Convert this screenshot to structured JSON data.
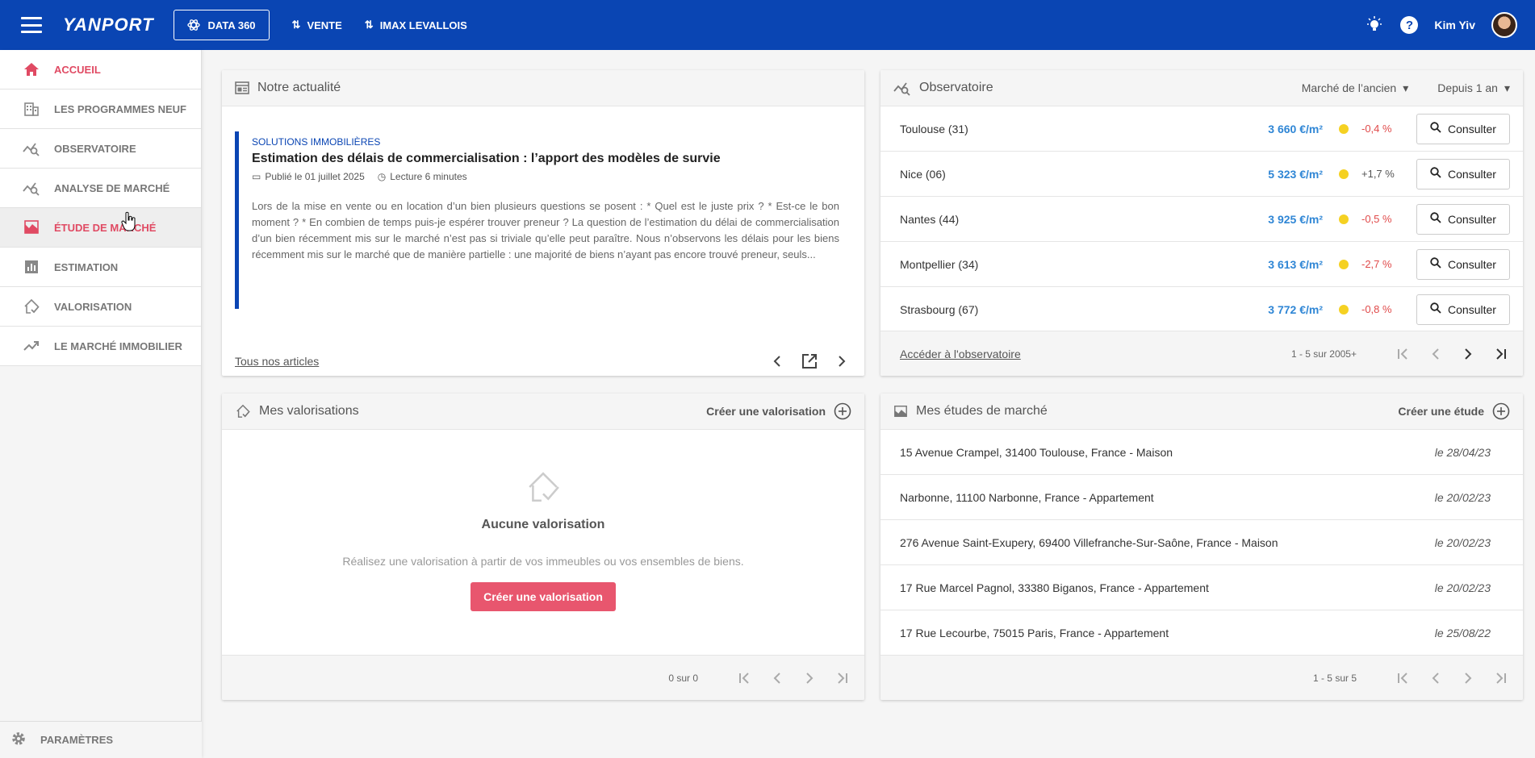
{
  "topbar": {
    "logo_text": "YANPORT",
    "data360_label": "DATA 360",
    "vente_label": "VENTE",
    "agency_label": "IMAX LEVALLOIS",
    "user_name": "Kim Yiv",
    "help_glyph": "?",
    "brand_color": "#0a45b3"
  },
  "sidebar": {
    "items": [
      {
        "label": "ACCUEIL",
        "icon": "home-icon"
      },
      {
        "label": "LES PROGRAMMES NEUF",
        "icon": "building-icon"
      },
      {
        "label": "OBSERVATOIRE",
        "icon": "chart-search-icon"
      },
      {
        "label": "ANALYSE DE MARCHÉ",
        "icon": "chart-search-icon"
      },
      {
        "label": "ÉTUDE DE MARCHÉ",
        "icon": "landscape-chart-icon"
      },
      {
        "label": "ESTIMATION",
        "icon": "bar-chart-icon"
      },
      {
        "label": "VALORISATION",
        "icon": "house-check-icon"
      },
      {
        "label": "LE MARCHÉ IMMOBILIER",
        "icon": "trending-up-icon"
      }
    ],
    "settings_label": "PARAMÈTRES",
    "accent_color": "#e04a63"
  },
  "news": {
    "title": "Notre actualité",
    "category": "SOLUTIONS IMMOBILIÈRES",
    "headline": "Estimation des délais de commercialisation : l’apport des modèles de survie",
    "published": "Publié le 01 juillet 2025",
    "reading": "Lecture 6 minutes",
    "text": "Lors de la mise en vente ou en location d’un bien plusieurs questions se posent : * Quel est le juste prix ? * Est-ce le bon moment ? * En combien de temps puis-je espérer trouver preneur ? La question de l’estimation du délai de commercialisation d’un bien récemment mis sur le marché n’est pas si triviale qu’elle peut paraître. Nous n’observons les délais pour les biens récemment mis sur le marché que de manière partielle : une majorité de biens n’ayant pas encore trouvé preneur, seuls...",
    "all_articles": "Tous nos articles"
  },
  "observatoire": {
    "title": "Observatoire",
    "market_select": "Marché de l’ancien",
    "period_select": "Depuis 1 an",
    "consult_label": "Consulter",
    "rows": [
      {
        "city": "Toulouse (31)",
        "price": "3 660 €/m²",
        "variation": "-0,4 %"
      },
      {
        "city": "Nice (06)",
        "price": "5 323 €/m²",
        "variation": "+1,7 %"
      },
      {
        "city": "Nantes (44)",
        "price": "3 925 €/m²",
        "variation": "-0,5 %"
      },
      {
        "city": "Montpellier (34)",
        "price": "3 613 €/m²",
        "variation": "-2,7 %"
      },
      {
        "city": "Strasbourg (67)",
        "price": "3 772 €/m²",
        "variation": "-0,8 %"
      }
    ],
    "footer_link": "Accéder à l'observatoire",
    "pagination": "1 - 5 sur 2005+"
  },
  "valorisations": {
    "title": "Mes valorisations",
    "create_label": "Créer une valorisation",
    "empty_title": "Aucune valorisation",
    "empty_sub": "Réalisez une valorisation à partir de vos immeubles ou vos ensembles de biens.",
    "empty_button": "Créer une valorisation",
    "pagination": "0 sur 0"
  },
  "etudes": {
    "title": "Mes études de marché",
    "create_label": "Créer une étude",
    "rows": [
      {
        "address": "15 Avenue Crampel, 31400 Toulouse, France - Maison",
        "date": "le 28/04/23"
      },
      {
        "address": "Narbonne, 11100 Narbonne, France - Appartement",
        "date": "le 20/02/23"
      },
      {
        "address": "276 Avenue Saint-Exupery, 69400 Villefranche-Sur-Saône, France - Maison",
        "date": "le 20/02/23"
      },
      {
        "address": "17 Rue Marcel Pagnol, 33380 Biganos, France - Appartement",
        "date": "le 20/02/23"
      },
      {
        "address": "17 Rue Lecourbe, 75015 Paris, France - Appartement",
        "date": "le 25/08/22"
      }
    ],
    "pagination": "1 - 5 sur 5"
  }
}
